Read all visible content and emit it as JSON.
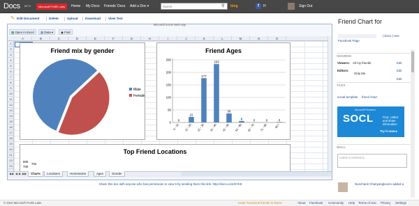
{
  "topbar": {
    "logo": "Docs",
    "beta": "BETA",
    "fuse_label": "Microsoft FUSE Labs",
    "nav": [
      "Home",
      "My Docs",
      "Friends' Docs",
      "Add a Doc ▾"
    ],
    "search_placeholder": "Search",
    "search_icon": "magnifier-icon",
    "bing_label": "bing",
    "user_name": "H",
    "signout": "Sign Out"
  },
  "toolbar": {
    "edit": "Edit Document",
    "delete": "Delete",
    "upload": "Upload",
    "download": "Download",
    "viewtext": "View Text"
  },
  "excel": {
    "app_title": "Microsoft Excel Web App",
    "open_in_excel": "Open in Excel",
    "data_menu": "Data ▾",
    "find": "Find",
    "columns": [
      "A",
      "B",
      "C",
      "D",
      "E",
      "F",
      "G",
      "H",
      "I",
      "J",
      "K",
      "L",
      "M",
      "N",
      "O"
    ],
    "rows": [
      "1",
      "2",
      "3",
      "4",
      "5",
      "6",
      "7",
      "8",
      "9",
      "10",
      "11",
      "12",
      "13",
      "14",
      "15",
      "16",
      "17",
      "18",
      "19",
      "20",
      "21",
      "22",
      "23"
    ],
    "sheet_tabs": [
      "Charts",
      "Locations",
      "Hometowns",
      "Ages",
      "Gender"
    ],
    "active_tab": "Charts"
  },
  "chart_data": [
    {
      "type": "pie",
      "title": "Friend mix by gender",
      "categories": [
        "Male",
        "Female"
      ],
      "values": [
        57,
        43
      ],
      "colors": [
        "#4f81bd",
        "#c0504d"
      ],
      "legend": "right"
    },
    {
      "type": "bar",
      "title": "Friend Ages",
      "categories": [
        "0 - 10",
        "11 - 20",
        "21 - 30",
        "31 - 40",
        "41 - 50",
        "51 - 60",
        "61 - 70",
        "71 - 80",
        "81+"
      ],
      "values": [
        0,
        22,
        177,
        233,
        36,
        6,
        0,
        0,
        2
      ],
      "ylim": [
        0,
        250
      ],
      "yticks": [
        0,
        50,
        100,
        150,
        200,
        250
      ],
      "color": "#4f81bd",
      "grid": true
    },
    {
      "type": "bar",
      "title": "Top Friend Locations",
      "yticks": [
        800,
        700
      ],
      "data_labels": [
        "702"
      ]
    }
  ],
  "share_text": "Share this doc with anyone who has permission to view it by sending them this link: http://docs.com/5YK9",
  "right_panel": {
    "title": "Friend Chart for",
    "author_suffix": "| Docs | Use",
    "fb_page": "Facebook Page",
    "sharing_head": "SHARING",
    "viewers_label": "Viewers:",
    "viewers_value": "All my friends",
    "editors_label": "Editors:",
    "editors_value": "Only Me",
    "edit_link": "Edit",
    "tags_head": "TAGS",
    "tags": [
      "social template",
      "friend chart"
    ],
    "ad": {
      "ms": "Microsoft® Research",
      "logo": "SOCL",
      "text": "Find, collect and share information",
      "cta": "Try it now ▸"
    },
    "wall_head": "WALL",
    "comment_placeholder": "Leave a comment...",
    "activity_user": "Nunchanit Chanyangkoonn added a"
  },
  "footer": {
    "copyright": "© 2010 Microsoft FUSE Labs",
    "invite": "Invite Facebook friends to Docs!",
    "links": [
      "About",
      "Facebook",
      "Community",
      "Help",
      "Terms of Use",
      "Privacy",
      "Settings"
    ]
  }
}
